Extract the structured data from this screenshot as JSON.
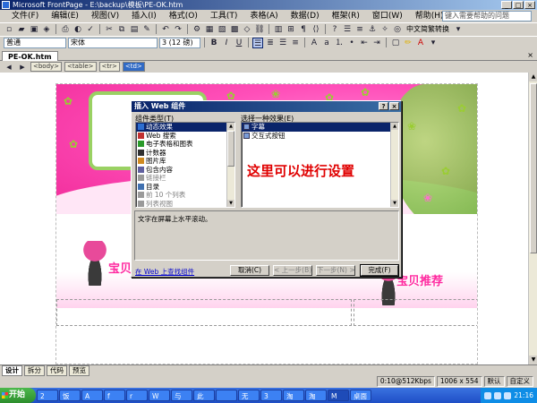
{
  "window": {
    "title": "Microsoft FrontPage - E:\\backup\\模板\\PE-OK.htm",
    "min": "_",
    "max": "□",
    "close": "×"
  },
  "menu": [
    "文件(F)",
    "编辑(E)",
    "视图(V)",
    "插入(I)",
    "格式(O)",
    "工具(T)",
    "表格(A)",
    "数据(D)",
    "框架(R)",
    "窗口(W)",
    "帮助(H)"
  ],
  "help_search": {
    "placeholder": "键入需要帮助的问题"
  },
  "toolbar2": {
    "style": "普通",
    "font": "宋体",
    "size": "3 (12 磅)",
    "lang": "中文简繁转换"
  },
  "doc_tab": {
    "name": "PE-OK.htm",
    "close": "×"
  },
  "tags": [
    "<body>",
    "<table>",
    "<tr>",
    "<td>"
  ],
  "dialog": {
    "title": "插入 Web 组件",
    "help": "?",
    "close": "×",
    "type_label": "组件类型(T)",
    "effect_label": "选择一种效果(E)",
    "types": [
      {
        "label": "动态效果",
        "selected": true,
        "color": "#2d6ed0"
      },
      {
        "label": "Web 搜索",
        "color": "#c03030"
      },
      {
        "label": "电子表格和图表",
        "color": "#2a9a2a"
      },
      {
        "label": "计数器",
        "color": "#303030"
      },
      {
        "label": "图片库",
        "color": "#d08a20"
      },
      {
        "label": "包含内容",
        "color": "#6060a0"
      },
      {
        "label": "链接栏",
        "dim": true,
        "color": "#9a9a9a"
      },
      {
        "label": "目录",
        "color": "#4070b0"
      },
      {
        "label": "前 10 个列表",
        "dim": true,
        "color": "#9a9a9a"
      },
      {
        "label": "列表视图",
        "dim": true,
        "color": "#9a9a9a"
      }
    ],
    "effects": [
      {
        "label": "字幕",
        "selected": true
      },
      {
        "label": "交互式按钮"
      }
    ],
    "description": "文字在屏幕上水平滚动。",
    "web_link": "在 Web 上查找组件",
    "buttons": {
      "cancel": "取消(C)",
      "back": "< 上一步(B)",
      "next": "下一步(N) >",
      "finish": "完成(F)"
    }
  },
  "annotation": "这里可以进行设置",
  "page": {
    "title_left": "宝贝放大",
    "title_right": "宝贝推荐"
  },
  "view_tabs": [
    "设计",
    "拆分",
    "代码",
    "预览"
  ],
  "status": [
    "0:10@512Kbps",
    "1006 x 554",
    "默认",
    "自定义"
  ],
  "taskbar": {
    "start": "开始",
    "tasks": [
      "2",
      "饭",
      "A",
      "f",
      "r",
      "W",
      "与",
      "此",
      "",
      "无",
      "3",
      "淘",
      "淘",
      "M",
      "桌面"
    ],
    "clock": "21:16"
  }
}
